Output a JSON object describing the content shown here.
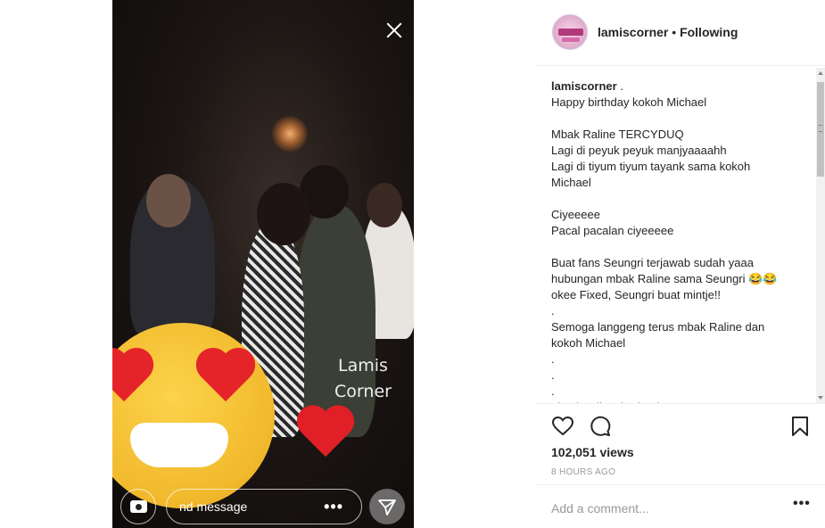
{
  "video": {
    "watermark_line1": "Lamis",
    "watermark_line2": "Corner",
    "message_placeholder": "Send message",
    "message_visible": "nd message",
    "more_label": "•••"
  },
  "post": {
    "username": "lamiscorner",
    "separator": "•",
    "follow_status": "Following",
    "caption_user": "lamiscorner",
    "caption_user_suffix": ".",
    "caption_lines": [
      "Happy birthday kokoh Michael",
      "",
      "Mbak Raline TERCYDUQ",
      "Lagi di peyuk peyuk manjyaaaahh",
      "Lagi di tiyum tiyum tayank sama kokoh",
      "Michael",
      "",
      "Ciyeeeee",
      "Pacal pacalan ciyeeeee",
      "",
      "Buat fans Seungri terjawab sudah yaaa",
      "hubungan mbak Raline sama Seungri 😂😂",
      "okee Fixed, Seungri buat mintje!!",
      ".",
      "Semoga langgeng terus mbak Raline dan",
      "kokoh Michael",
      ".",
      ".",
      ".",
      "#lamiscalingshaderobe"
    ],
    "views": "102,051 views",
    "time_ago": "8 HOURS AGO",
    "comment_placeholder": "Add a comment...",
    "more_label": "•••"
  },
  "icons": {
    "close": "close-icon",
    "camera": "camera-icon",
    "send": "send-icon",
    "like": "heart-icon",
    "comment": "comment-icon",
    "save": "bookmark-icon"
  }
}
